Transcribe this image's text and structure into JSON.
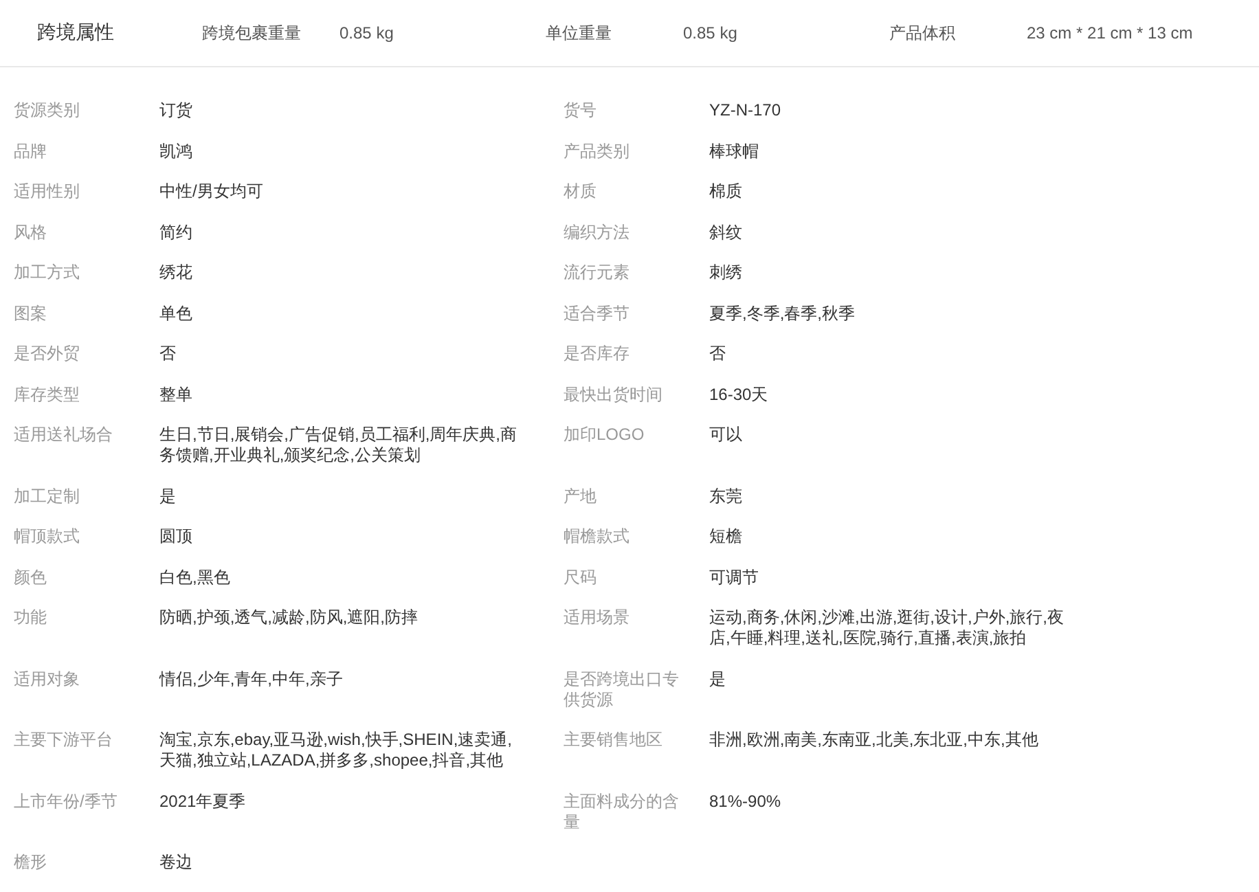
{
  "cross_border": {
    "title": "跨境属性",
    "fields": [
      {
        "label": "跨境包裹重量",
        "value": "0.85 kg"
      },
      {
        "label": "单位重量",
        "value": "0.85 kg"
      },
      {
        "label": "产品体积",
        "value": "23 cm * 21 cm * 13 cm"
      }
    ]
  },
  "attributes": [
    {
      "label": "货源类别",
      "value": "订货"
    },
    {
      "label": "货号",
      "value": "YZ-N-170"
    },
    {
      "label": "品牌",
      "value": "凯鸿"
    },
    {
      "label": "产品类别",
      "value": "棒球帽"
    },
    {
      "label": "适用性别",
      "value": "中性/男女均可"
    },
    {
      "label": "材质",
      "value": "棉质"
    },
    {
      "label": "风格",
      "value": "简约"
    },
    {
      "label": "编织方法",
      "value": "斜纹"
    },
    {
      "label": "加工方式",
      "value": "绣花"
    },
    {
      "label": "流行元素",
      "value": "刺绣"
    },
    {
      "label": "图案",
      "value": "单色"
    },
    {
      "label": "适合季节",
      "value": "夏季,冬季,春季,秋季"
    },
    {
      "label": "是否外贸",
      "value": "否"
    },
    {
      "label": "是否库存",
      "value": "否"
    },
    {
      "label": "库存类型",
      "value": "整单"
    },
    {
      "label": "最快出货时间",
      "value": "16-30天"
    },
    {
      "label": "适用送礼场合",
      "value": "生日,节日,展销会,广告促销,员工福利,周年庆典,商务馈赠,开业典礼,颁奖纪念,公关策划"
    },
    {
      "label": "加印LOGO",
      "value": "可以"
    },
    {
      "label": "加工定制",
      "value": "是"
    },
    {
      "label": "产地",
      "value": "东莞"
    },
    {
      "label": "帽顶款式",
      "value": "圆顶"
    },
    {
      "label": "帽檐款式",
      "value": "短檐"
    },
    {
      "label": "颜色",
      "value": "白色,黑色"
    },
    {
      "label": "尺码",
      "value": "可调节"
    },
    {
      "label": "功能",
      "value": "防晒,护颈,透气,减龄,防风,遮阳,防摔"
    },
    {
      "label": "适用场景",
      "value": "运动,商务,休闲,沙滩,出游,逛街,设计,户外,旅行,夜店,午睡,料理,送礼,医院,骑行,直播,表演,旅拍"
    },
    {
      "label": "适用对象",
      "value": "情侣,少年,青年,中年,亲子"
    },
    {
      "label": "是否跨境出口专供货源",
      "value": "是"
    },
    {
      "label": "主要下游平台",
      "value": "淘宝,京东,ebay,亚马逊,wish,快手,SHEIN,速卖通,天猫,独立站,LAZADA,拼多多,shopee,抖音,其他"
    },
    {
      "label": "主要销售地区",
      "value": "非洲,欧洲,南美,东南亚,北美,东北亚,中东,其他"
    },
    {
      "label": "上市年份/季节",
      "value": "2021年夏季"
    },
    {
      "label": "主面料成分的含量",
      "value": "81%-90%"
    },
    {
      "label": "檐形",
      "value": "卷边"
    }
  ]
}
